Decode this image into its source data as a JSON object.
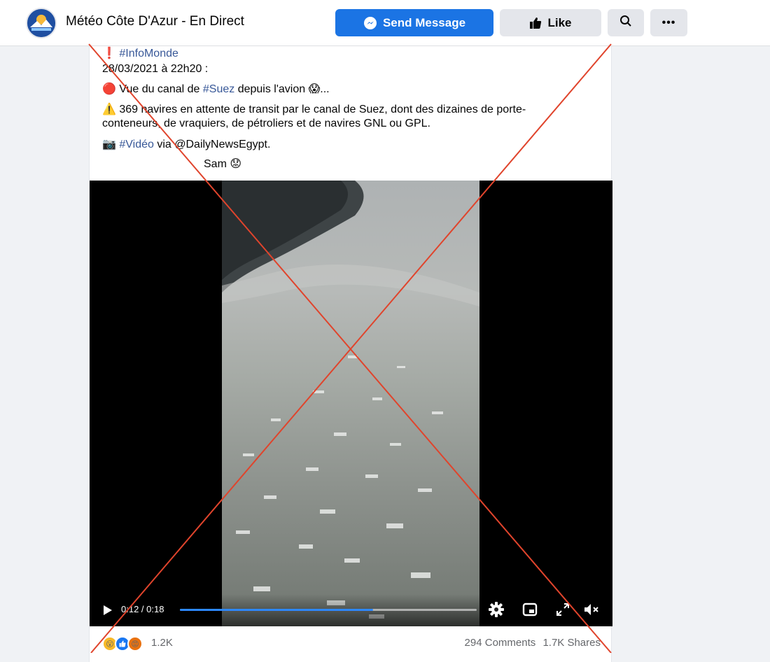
{
  "header": {
    "page_name": "Météo Côte D'Azur - En Direct",
    "send_message_label": "Send Message",
    "like_label": "Like",
    "more_label": "•••"
  },
  "post": {
    "line1_prefix": "❗ ",
    "line1_hashtag": "#InfoMonde",
    "line2": "28/03/2021 à 22h20 :",
    "line3_prefix": "🔴 Vue du canal de ",
    "line3_hashtag": "#Suez",
    "line3_suffix": " depuis l'avion 😱...",
    "line4": "⚠️ 369 navires en attente de transit par le canal de Suez, dont des dizaines de porte-",
    "line5": "conteneurs, de vraquiers, de pétroliers et de navires GNL ou GPL.",
    "line6_prefix": "📷 ",
    "line6_hashtag": "#Vidéo",
    "line6_suffix": " via @DailyNewsEgypt.",
    "line7": "Sam 😟"
  },
  "video": {
    "time": "0:12 / 0:18",
    "progress_fraction": 0.65
  },
  "footer": {
    "reaction_count": "1.2K",
    "comments": "294 Comments",
    "shares": "1.7K Shares"
  },
  "colors": {
    "accent": "#1b74e4",
    "hashtag": "#385898",
    "progress": "#2d88ff",
    "overlay_cross": "#e0442c"
  }
}
